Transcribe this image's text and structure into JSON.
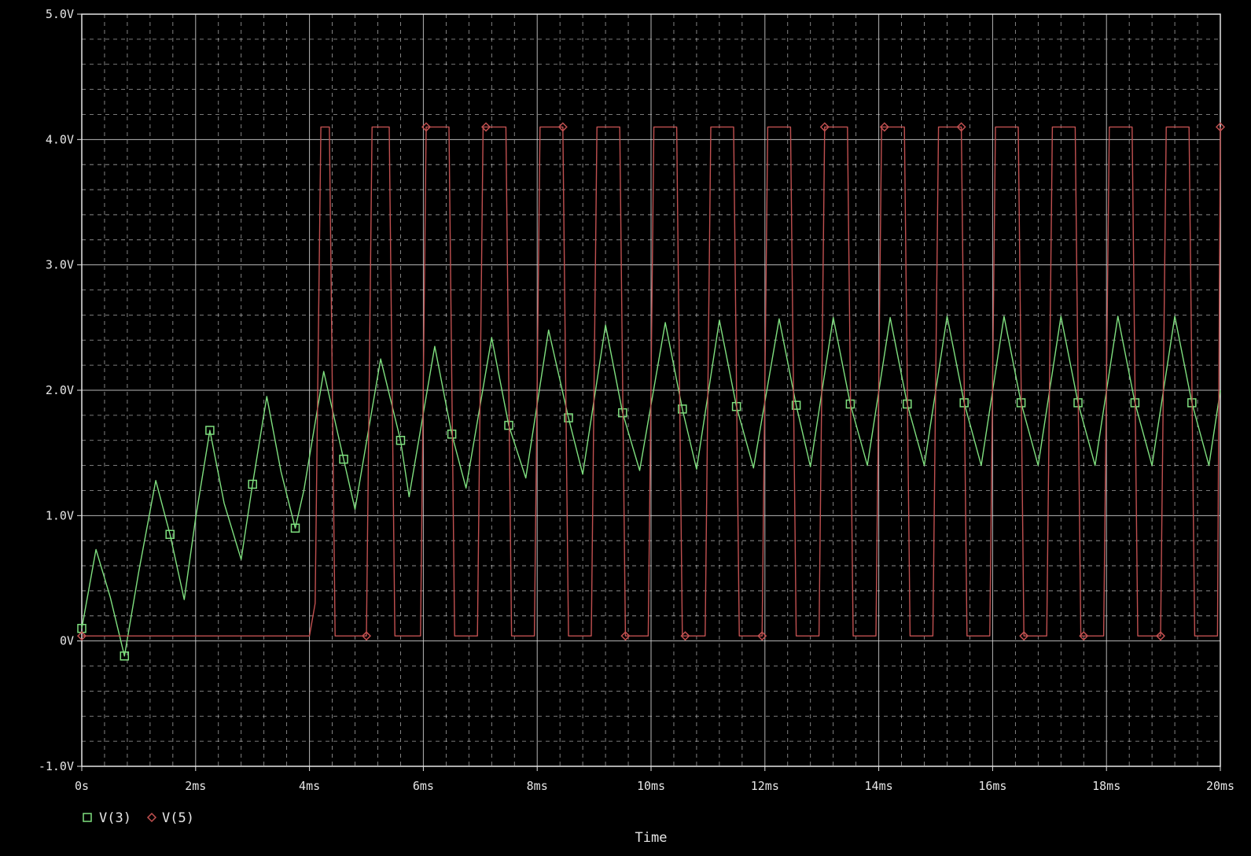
{
  "chart_data": {
    "type": "line",
    "xlabel": "Time",
    "ylabel": "",
    "title": "",
    "x_unit_ticks": [
      "0s",
      "2ms",
      "4ms",
      "6ms",
      "8ms",
      "10ms",
      "12ms",
      "14ms",
      "16ms",
      "18ms",
      "20ms"
    ],
    "y_unit_ticks": [
      "5.0V",
      "4.0V",
      "3.0V",
      "2.0V",
      "1.0V",
      "0V",
      "-1.0V"
    ],
    "xlim": [
      0,
      20
    ],
    "ylim": [
      -1.0,
      5.0
    ],
    "grid": true,
    "legend_position": "bottom-left",
    "colors": {
      "background": "#000000",
      "grid": "#d8d8d8",
      "axis": "#e6e6e6",
      "v3": "#7fe07f",
      "v5": "#c05050"
    },
    "series": [
      {
        "name": "V(3)",
        "marker": "square",
        "color": "#7fe07f",
        "x": [
          0.0,
          0.25,
          0.5,
          0.75,
          1.0,
          1.3,
          1.55,
          1.8,
          2.0,
          2.25,
          2.5,
          2.8,
          3.0,
          3.25,
          3.5,
          3.75,
          3.9,
          4.25,
          4.6,
          4.8,
          5.25,
          5.6,
          5.75,
          6.2,
          6.5,
          6.75,
          7.2,
          7.5,
          7.8,
          8.2,
          8.55,
          8.8,
          9.2,
          9.5,
          9.8,
          10.25,
          10.55,
          10.8,
          11.2,
          11.5,
          11.8,
          12.25,
          12.55,
          12.8,
          13.2,
          13.5,
          13.8,
          14.2,
          14.5,
          14.8,
          15.2,
          15.5,
          15.8,
          16.2,
          16.5,
          16.8,
          17.2,
          17.5,
          17.8,
          18.2,
          18.5,
          18.8,
          19.2,
          19.5,
          19.8,
          20.0
        ],
        "y": [
          0.1,
          0.73,
          0.35,
          -0.12,
          0.55,
          1.28,
          0.85,
          0.33,
          0.98,
          1.68,
          1.1,
          0.65,
          1.25,
          1.95,
          1.35,
          0.9,
          1.2,
          2.15,
          1.45,
          1.05,
          2.25,
          1.6,
          1.15,
          2.35,
          1.65,
          1.22,
          2.42,
          1.72,
          1.3,
          2.48,
          1.78,
          1.33,
          2.52,
          1.82,
          1.36,
          2.54,
          1.85,
          1.37,
          2.56,
          1.87,
          1.38,
          2.57,
          1.88,
          1.39,
          2.58,
          1.89,
          1.4,
          2.58,
          1.89,
          1.4,
          2.59,
          1.9,
          1.4,
          2.59,
          1.9,
          1.4,
          2.59,
          1.9,
          1.4,
          2.59,
          1.9,
          1.4,
          2.59,
          1.9,
          1.4,
          2.0
        ]
      },
      {
        "name": "V(5)",
        "marker": "diamond",
        "color": "#c05050",
        "x": [
          0.0,
          4.0,
          4.1,
          4.2,
          4.35,
          4.45,
          4.55,
          5.0,
          5.1,
          5.2,
          5.4,
          5.5,
          5.55,
          5.95,
          6.05,
          6.1,
          6.45,
          6.55,
          6.6,
          6.95,
          7.05,
          7.1,
          7.45,
          7.55,
          7.6,
          7.95,
          8.05,
          8.1,
          8.45,
          8.55,
          8.6,
          8.95,
          9.05,
          9.1,
          9.45,
          9.55,
          9.6,
          9.95,
          10.05,
          10.1,
          10.45,
          10.55,
          10.6,
          10.95,
          11.05,
          11.1,
          11.45,
          11.55,
          11.6,
          11.95,
          12.05,
          12.1,
          12.45,
          12.55,
          12.6,
          12.95,
          13.05,
          13.1,
          13.45,
          13.55,
          13.6,
          13.95,
          14.05,
          14.1,
          14.45,
          14.55,
          14.6,
          14.95,
          15.05,
          15.1,
          15.45,
          15.55,
          15.6,
          15.95,
          16.05,
          16.1,
          16.45,
          16.55,
          16.6,
          16.95,
          17.05,
          17.1,
          17.45,
          17.55,
          17.6,
          17.95,
          18.05,
          18.1,
          18.45,
          18.55,
          18.6,
          18.95,
          19.05,
          19.1,
          19.45,
          19.55,
          19.6,
          19.95,
          20.0
        ],
        "y": [
          0.04,
          0.04,
          0.3,
          4.1,
          4.1,
          0.04,
          0.04,
          0.04,
          4.1,
          4.1,
          4.1,
          0.04,
          0.04,
          0.04,
          4.1,
          4.1,
          4.1,
          0.04,
          0.04,
          0.04,
          4.1,
          4.1,
          4.1,
          0.04,
          0.04,
          0.04,
          4.1,
          4.1,
          4.1,
          0.04,
          0.04,
          0.04,
          4.1,
          4.1,
          4.1,
          0.04,
          0.04,
          0.04,
          4.1,
          4.1,
          4.1,
          0.04,
          0.04,
          0.04,
          4.1,
          4.1,
          4.1,
          0.04,
          0.04,
          0.04,
          4.1,
          4.1,
          4.1,
          0.04,
          0.04,
          0.04,
          4.1,
          4.1,
          4.1,
          0.04,
          0.04,
          0.04,
          4.1,
          4.1,
          4.1,
          0.04,
          0.04,
          0.04,
          4.1,
          4.1,
          4.1,
          0.04,
          0.04,
          0.04,
          4.1,
          4.1,
          4.1,
          0.04,
          0.04,
          0.04,
          4.1,
          4.1,
          4.1,
          0.04,
          0.04,
          0.04,
          4.1,
          4.1,
          4.1,
          0.04,
          0.04,
          0.04,
          4.1,
          4.1,
          4.1,
          0.04,
          0.04,
          0.04,
          4.1
        ]
      }
    ]
  }
}
